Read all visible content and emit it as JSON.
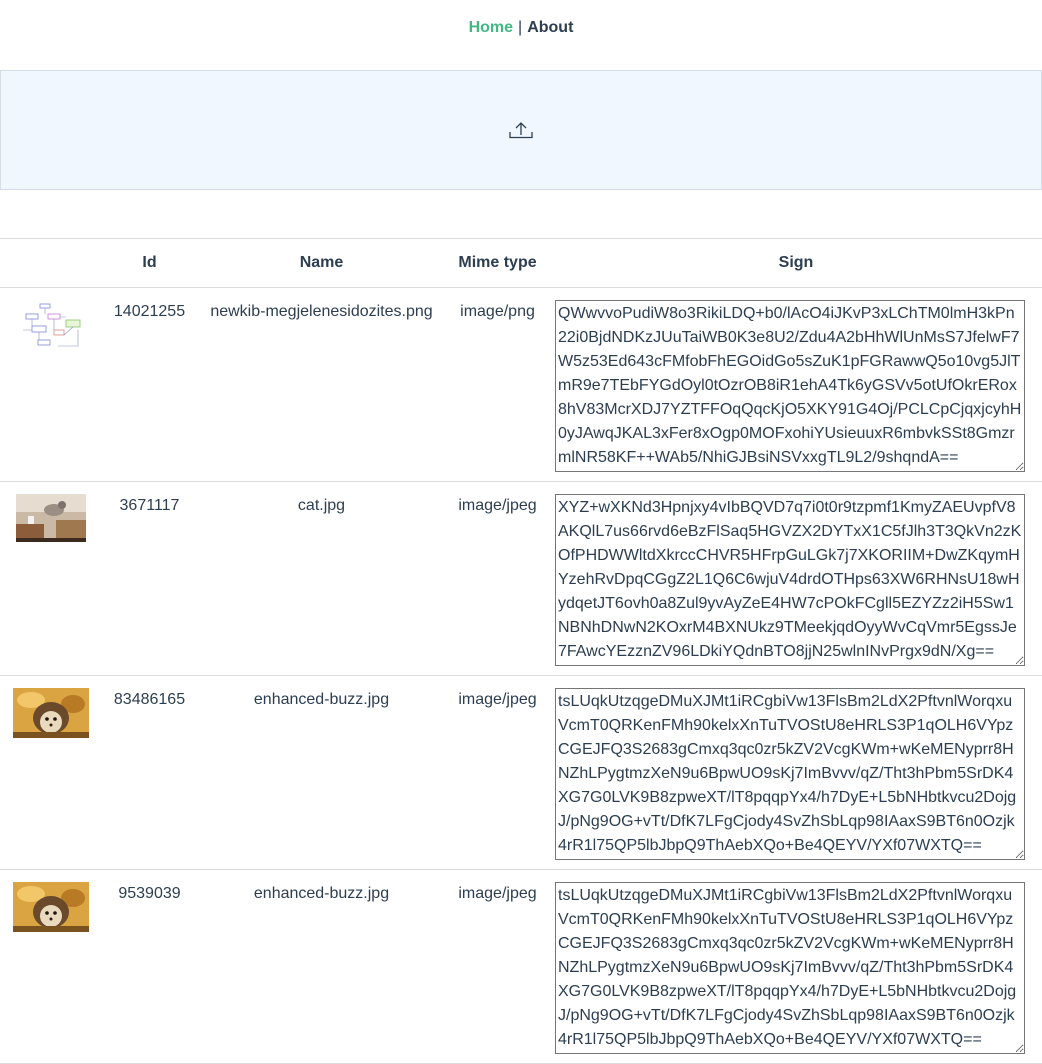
{
  "nav": {
    "home": "Home",
    "separator": "|",
    "about": "About"
  },
  "upload": {
    "icon": "upload-icon"
  },
  "table": {
    "headers": {
      "thumb": "",
      "id": "Id",
      "name": "Name",
      "mime": "Mime type",
      "sign": "Sign"
    },
    "rows": [
      {
        "thumb": "diagram-thumbnail",
        "id": "14021255",
        "name": "newkib-megjelenesidozites.png",
        "mime": "image/png",
        "sign": "QWwvvoPudiW8o3RikiLDQ+b0/lAcO4iJKvP3xLChTM0lmH3kPn22i0BjdNDKzJUuTaiWB0K3e8U2/Zdu4A2bHhWlUnMsS7JfelwF7W5z53Ed643cFMfobFhEGOidGo5sZuK1pFGRawwQ5o10vg5JlTmR9e7TEbFYGdOyl0tOzrOB8iR1ehA4Tk6yGSVv5otUfOkrERox8hV83McrXDJ7YZTFFOqQqcKjO5XKY91G4Oj/PCLCpCjqxjcyhH0yJAwqJKAL3xFer8xOgp0MOFxohiYUsieuuxR6mbvkSSt8GmzrmlNR58KF++WAb5/NhiGJBsiNSVxxgTL9L2/9shqndA=="
      },
      {
        "thumb": "cat-photo-thumbnail",
        "id": "3671117",
        "name": "cat.jpg",
        "mime": "image/jpeg",
        "sign": "XYZ+wXKNd3Hpnjxy4vIbBQVD7q7i0t0r9tzpmf1KmyZAEUvpfV8AKQlL7us66rvd6eBzFlSaq5HGVZX2DYTxX1C5fJlh3T3QkVn2zKOfPHDWWltdXkrccCHVR5HFrpGuLGk7j7XKORIIM+DwZKqymHYzehRvDpqCGgZ2L1Q6C6wjuV4drdOTHps63XW6RHNsU18wHydqetJT6ovh0a8Zul9yvAyZeE4HW7cPOkFCgll5EZYZz2iH5Sw1NBNhDNwN2KOxrM4BXNUkz9TMeekjqdOyyWvCqVmr5EgssJe7FAwcYEzznZV96LDkiYQdnBTO8jjN25wlnINvPrgx9dN/Xg=="
      },
      {
        "thumb": "hedgehog-photo-thumbnail",
        "id": "83486165",
        "name": "enhanced-buzz.jpg",
        "mime": "image/jpeg",
        "sign": "tsLUqkUtzqgeDMuXJMt1iRCgbiVw13FlsBm2LdX2PftvnlWorqxuVcmT0QRKenFMh90kelxXnTuTVOStU8eHRLS3P1qOLH6VYpzCGEJFQ3S2683gCmxq3qc0zr5kZV2VcgKWm+wKeMENyprr8HNZhLPygtmzXeN9u6BpwUO9sKj7ImBvvv/qZ/Tht3hPbm5SrDK4XG7G0LVK9B8zpweXT/lT8pqqpYx4/h7DyE+L5bNHbtkvcu2DojgJ/pNg9OG+vTt/DfK7LFgCjody4SvZhSbLqp98IAaxS9BT6n0Ozjk4rR1l75QP5lbJbpQ9ThAebXQo+Be4QEYV/YXf07WXTQ=="
      },
      {
        "thumb": "hedgehog-photo-thumbnail",
        "id": "9539039",
        "name": "enhanced-buzz.jpg",
        "mime": "image/jpeg",
        "sign": "tsLUqkUtzqgeDMuXJMt1iRCgbiVw13FlsBm2LdX2PftvnlWorqxuVcmT0QRKenFMh90kelxXnTuTVOStU8eHRLS3P1qOLH6VYpzCGEJFQ3S2683gCmxq3qc0zr5kZV2VcgKWm+wKeMENyprr8HNZhLPygtmzXeN9u6BpwUO9sKj7ImBvvv/qZ/Tht3hPbm5SrDK4XG7G0LVK9B8zpweXT/lT8pqqpYx4/h7DyE+L5bNHbtkvcu2DojgJ/pNg9OG+vTt/DfK7LFgCjody4SvZhSbLqp98IAaxS9BT6n0Ozjk4rR1l75QP5lbJbpQ9ThAebXQo+Be4QEYV/YXf07WXTQ=="
      }
    ]
  }
}
